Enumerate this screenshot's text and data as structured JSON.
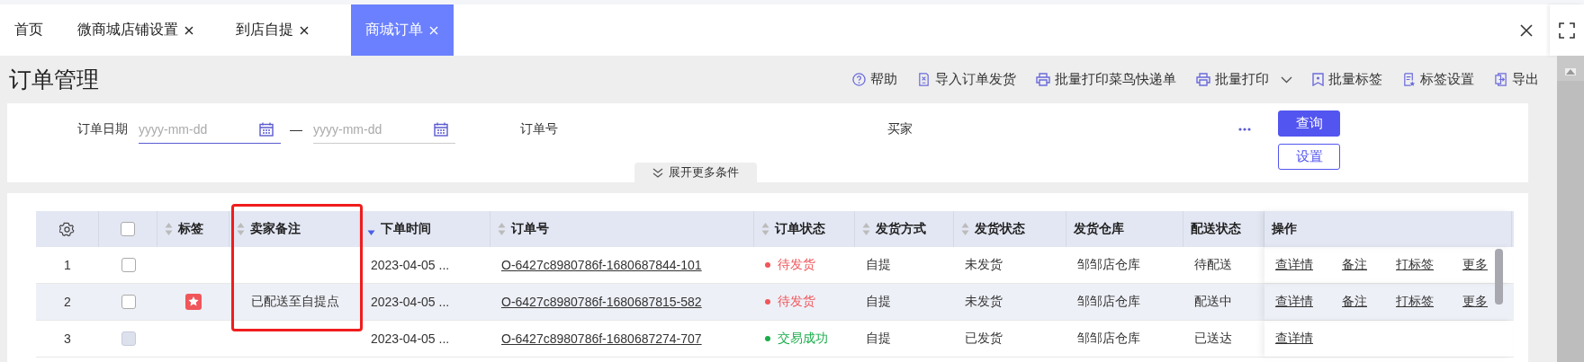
{
  "tabs": [
    {
      "label": "首页",
      "closable": false,
      "selected": false
    },
    {
      "label": "微商城店铺设置",
      "closable": true,
      "selected": false
    },
    {
      "label": "到店自提",
      "closable": true,
      "selected": false
    },
    {
      "label": "商城订单",
      "closable": true,
      "selected": true
    }
  ],
  "page_title": "订单管理",
  "toolbar": [
    {
      "kind": "help",
      "label": "帮助",
      "dropdown": false
    },
    {
      "kind": "import",
      "label": "导入订单发货",
      "dropdown": false
    },
    {
      "kind": "print",
      "label": "批量打印菜鸟快递单",
      "dropdown": false
    },
    {
      "kind": "print",
      "label": "批量打印",
      "dropdown": true
    },
    {
      "kind": "tag",
      "label": "批量标签",
      "dropdown": false
    },
    {
      "kind": "settings",
      "label": "标签设置",
      "dropdown": false
    },
    {
      "kind": "export",
      "label": "导出",
      "dropdown": false
    }
  ],
  "filters": {
    "date_label": "订单日期",
    "date_start": {
      "placeholder": "yyyy-mm-dd",
      "focused": true
    },
    "date_separator": "—",
    "date_end": {
      "placeholder": "yyyy-mm-dd",
      "focused": false
    },
    "order_label": "订单号",
    "buyer_label": "买家",
    "query_button": "查询",
    "settings_button": "设置",
    "expand_toggle": "展开更多条件"
  },
  "table": {
    "all_checked": false,
    "columns": [
      {
        "label": "标签",
        "sortable": true,
        "sorted": false
      },
      {
        "label": "卖家备注",
        "sortable": true,
        "sorted": false
      },
      {
        "label": "下单时间",
        "sortable": true,
        "sorted": true
      },
      {
        "label": "订单号",
        "sortable": true,
        "sorted": false
      },
      {
        "label": "订单状态",
        "sortable": true,
        "sorted": false
      },
      {
        "label": "发货方式",
        "sortable": true,
        "sorted": false
      },
      {
        "label": "发货状态",
        "sortable": true,
        "sorted": false
      },
      {
        "label": "发货仓库",
        "sortable": false
      },
      {
        "label": "配送状态",
        "sortable": false
      },
      {
        "label": "操作",
        "sortable": false
      }
    ],
    "rows": [
      {
        "index": "1",
        "checked": false,
        "disabled": false,
        "hovered": false,
        "tagged": false,
        "note": "",
        "time": "2023-04-05 ...",
        "order_no": "O-6427c8980786f-1680687844-101",
        "status": {
          "text": "待发货",
          "color": "#f0565a"
        },
        "shipping_method": "自提",
        "shipping_status": "未发货",
        "warehouse": "邹邹店仓库",
        "delivery_status": "待配送",
        "actions": [
          "查详情",
          "备注",
          "打标签",
          "更多"
        ]
      },
      {
        "index": "2",
        "checked": false,
        "disabled": false,
        "hovered": true,
        "tagged": true,
        "note": "已配送至自提点",
        "time": "2023-04-05 ...",
        "order_no": "O-6427c8980786f-1680687815-582",
        "status": {
          "text": "待发货",
          "color": "#f0565a"
        },
        "shipping_method": "自提",
        "shipping_status": "未发货",
        "warehouse": "邹邹店仓库",
        "delivery_status": "配送中",
        "actions": [
          "查详情",
          "备注",
          "打标签",
          "更多"
        ]
      },
      {
        "index": "3",
        "checked": false,
        "disabled": true,
        "hovered": false,
        "tagged": false,
        "note": "",
        "time": "2023-04-05 ...",
        "order_no": "O-6427c8980786f-1680687274-707",
        "status": {
          "text": "交易成功",
          "color": "#1aad4b"
        },
        "shipping_method": "自提",
        "shipping_status": "已发货",
        "warehouse": "邹邹店仓库",
        "delivery_status": "已送达",
        "actions": [
          "查详情"
        ]
      }
    ]
  }
}
